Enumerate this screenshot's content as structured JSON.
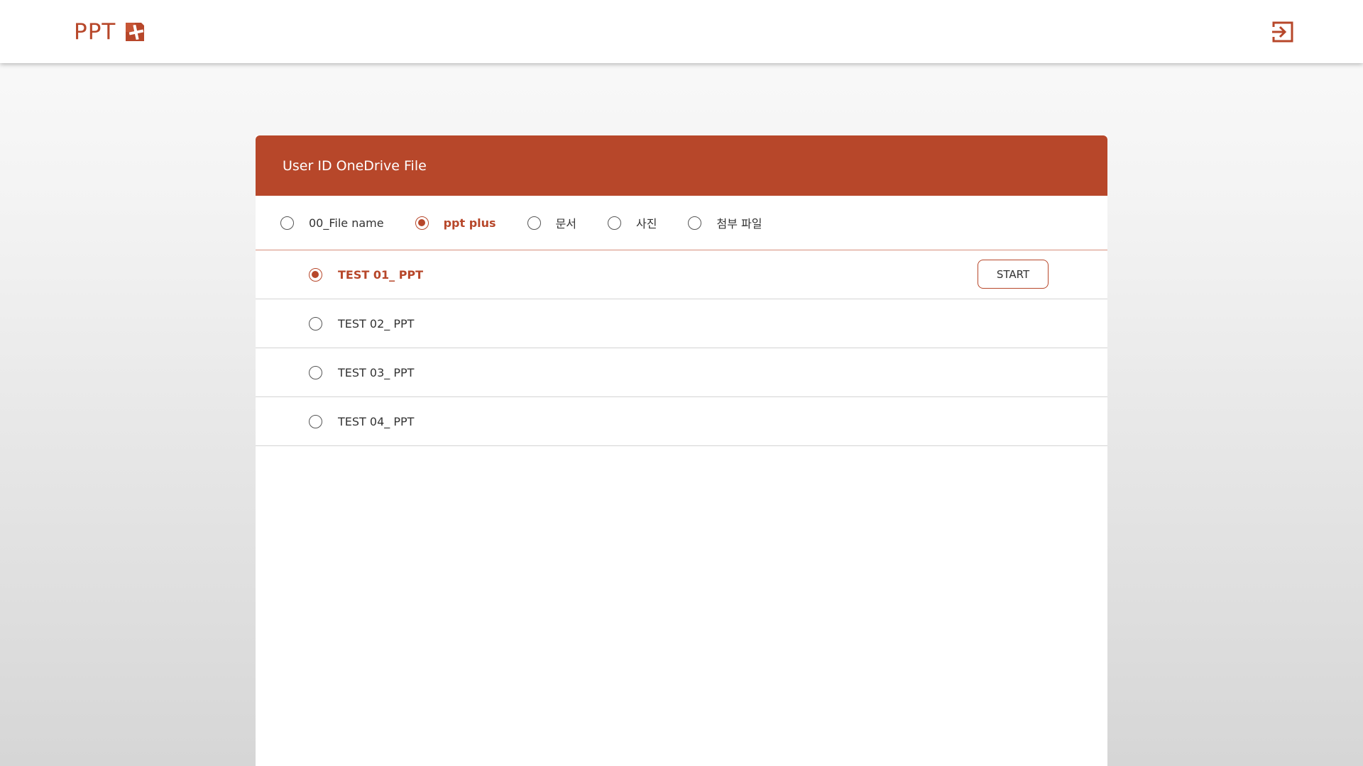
{
  "app": {
    "logo_text": "PPT",
    "logo_icon": "ppt-plus-logo-icon",
    "logout_icon": "logout-icon",
    "accent_color": "#b7472a"
  },
  "panel": {
    "title": "User ID  OneDrive File",
    "filters": [
      {
        "label": "00_File name",
        "selected": false
      },
      {
        "label": "ppt plus",
        "selected": true
      },
      {
        "label": "문서",
        "selected": false
      },
      {
        "label": "사진",
        "selected": false
      },
      {
        "label": "첨부 파일",
        "selected": false
      }
    ],
    "files": [
      {
        "label": "TEST 01_ PPT",
        "selected": true
      },
      {
        "label": "TEST 02_ PPT",
        "selected": false
      },
      {
        "label": "TEST 03_ PPT",
        "selected": false
      },
      {
        "label": "TEST 04_ PPT",
        "selected": false
      }
    ],
    "start_label": "START"
  }
}
